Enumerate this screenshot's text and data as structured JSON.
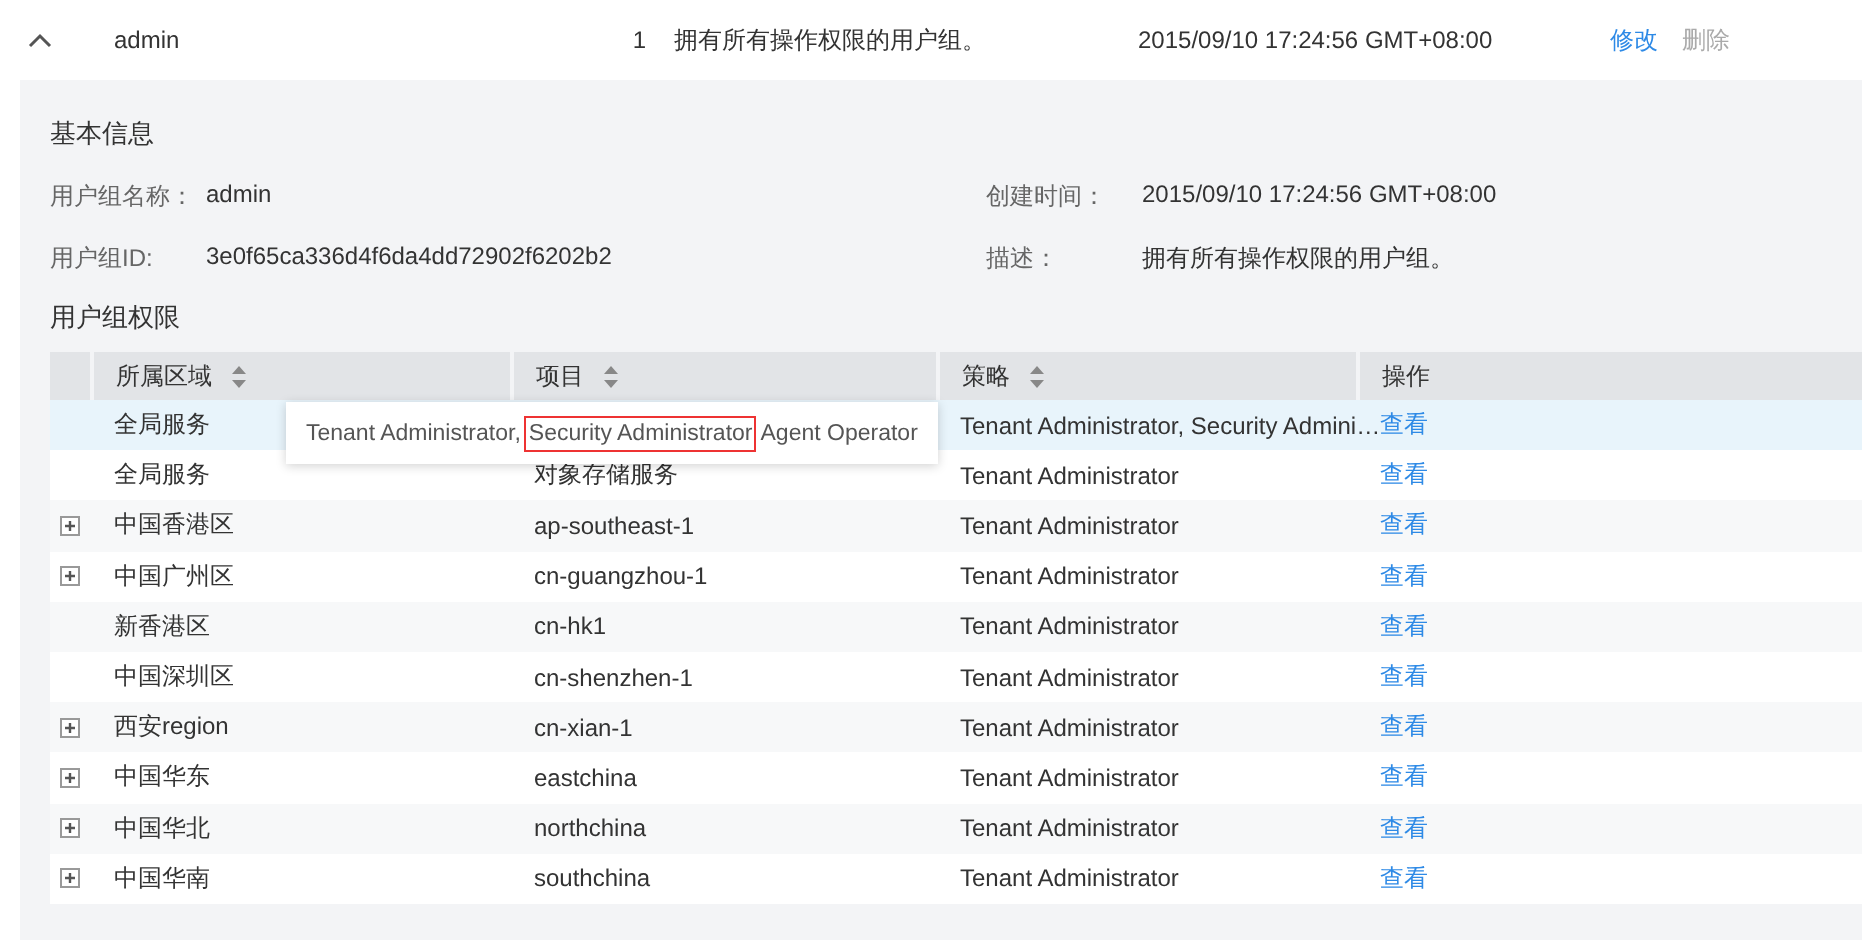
{
  "group_row": {
    "expanded": true,
    "name": "admin",
    "count": "1",
    "description": "拥有所有操作权限的用户组。",
    "created": "2015/09/10 17:24:56 GMT+08:00",
    "actions": [
      {
        "label": "修改",
        "disabled": false
      },
      {
        "label": "删除",
        "disabled": true
      }
    ]
  },
  "basic_info": {
    "title": "基本信息",
    "fields": [
      {
        "label": "用户组名称：",
        "value": "admin"
      },
      {
        "label": "创建时间：",
        "value": "2015/09/10 17:24:56 GMT+08:00"
      },
      {
        "label": "用户组ID:",
        "value": "3e0f65ca336d4f6da4dd72902f6202b2"
      },
      {
        "label": "描述：",
        "value": "拥有所有操作权限的用户组。"
      }
    ]
  },
  "permissions": {
    "title": "用户组权限",
    "columns": [
      {
        "label": "所属区域",
        "sortable": true
      },
      {
        "label": "项目",
        "sortable": true
      },
      {
        "label": "策略",
        "sortable": true
      },
      {
        "label": "操作",
        "sortable": false
      }
    ],
    "rows": [
      {
        "expandable": false,
        "highlighted": true,
        "region": "全局服务",
        "project": "",
        "policy": "Tenant Administrator, Security Admini…",
        "action": "查看"
      },
      {
        "expandable": false,
        "highlighted": false,
        "region": "全局服务",
        "project": "对象存储服务",
        "policy": "Tenant Administrator",
        "action": "查看"
      },
      {
        "expandable": true,
        "highlighted": false,
        "region": "中国香港区",
        "project": "ap-southeast-1",
        "policy": "Tenant Administrator",
        "action": "查看"
      },
      {
        "expandable": true,
        "highlighted": false,
        "region": "中国广州区",
        "project": "cn-guangzhou-1",
        "policy": "Tenant Administrator",
        "action": "查看"
      },
      {
        "expandable": false,
        "highlighted": false,
        "region": "新香港区",
        "project": "cn-hk1",
        "policy": "Tenant Administrator",
        "action": "查看"
      },
      {
        "expandable": false,
        "highlighted": false,
        "region": "中国深圳区",
        "project": "cn-shenzhen-1",
        "policy": "Tenant Administrator",
        "action": "查看"
      },
      {
        "expandable": true,
        "highlighted": false,
        "region": "西安region",
        "project": "cn-xian-1",
        "policy": "Tenant Administrator",
        "action": "查看"
      },
      {
        "expandable": true,
        "highlighted": false,
        "region": "中国华东",
        "project": "eastchina",
        "policy": "Tenant Administrator",
        "action": "查看"
      },
      {
        "expandable": true,
        "highlighted": false,
        "region": "中国华北",
        "project": "northchina",
        "policy": "Tenant Administrator",
        "action": "查看"
      },
      {
        "expandable": true,
        "highlighted": false,
        "region": "中国华南",
        "project": "southchina",
        "policy": "Tenant Administrator",
        "action": "查看"
      }
    ],
    "tooltip": {
      "segments": [
        {
          "text": "Tenant Administrator,",
          "highlighted": false
        },
        {
          "text": "Security Administrator",
          "highlighted": true
        },
        {
          "text": "Agent Operator",
          "highlighted": false
        }
      ]
    }
  }
}
